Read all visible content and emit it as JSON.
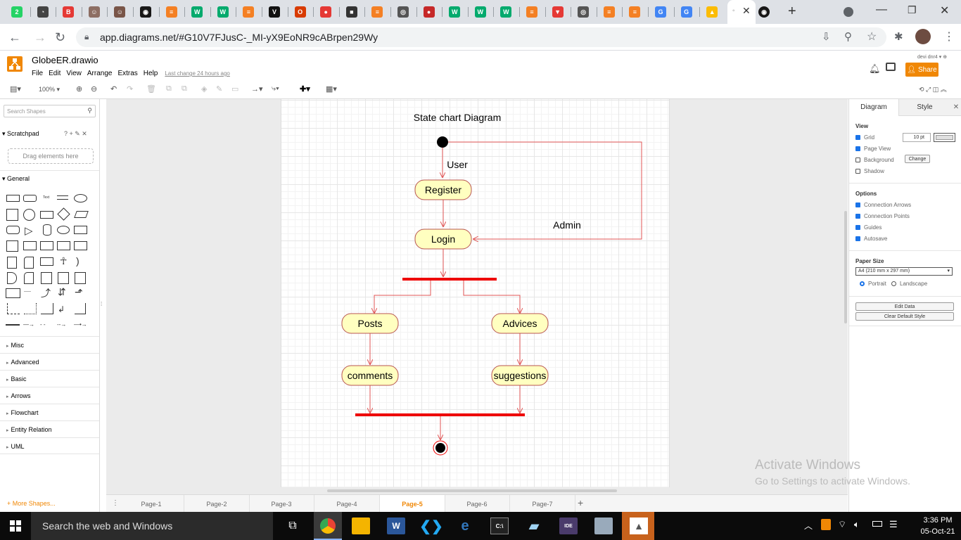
{
  "browser": {
    "url": "app.diagrams.net/#G10V7FJusC-_MI-yX9EoNR9cABrpen29Wy",
    "tabs": [
      {
        "icon": "whatsapp-icon",
        "color": "#25d366",
        "glyph": "2"
      },
      {
        "icon": "app-icon",
        "color": "#444",
        "glyph": "◔"
      },
      {
        "icon": "bookmark-icon",
        "color": "#e53935",
        "glyph": "B"
      },
      {
        "icon": "avatar-icon",
        "color": "#8d6e63",
        "glyph": "☺"
      },
      {
        "icon": "avatar-icon",
        "color": "#795548",
        "glyph": "☺"
      },
      {
        "icon": "github-icon",
        "color": "#181717",
        "glyph": "◉"
      },
      {
        "icon": "stackoverflow-icon",
        "color": "#f48024",
        "glyph": "≡"
      },
      {
        "icon": "w3schools-icon",
        "color": "#04aa6d",
        "glyph": "W"
      },
      {
        "icon": "w3schools-icon",
        "color": "#04aa6d",
        "glyph": "W"
      },
      {
        "icon": "stackoverflow-icon",
        "color": "#f48024",
        "glyph": "≡"
      },
      {
        "icon": "vercel-icon",
        "color": "#111",
        "glyph": "V"
      },
      {
        "icon": "office-icon",
        "color": "#d83b01",
        "glyph": "O"
      },
      {
        "icon": "record-icon",
        "color": "#e53935",
        "glyph": "●"
      },
      {
        "icon": "app-icon",
        "color": "#333",
        "glyph": "■"
      },
      {
        "icon": "stackoverflow-icon",
        "color": "#f48024",
        "glyph": "≡"
      },
      {
        "icon": "chrome-icon",
        "color": "#555",
        "glyph": "◎"
      },
      {
        "icon": "app-icon",
        "color": "#c62828",
        "glyph": "●"
      },
      {
        "icon": "w3schools-icon",
        "color": "#04aa6d",
        "glyph": "W"
      },
      {
        "icon": "w3schools-icon",
        "color": "#04aa6d",
        "glyph": "W"
      },
      {
        "icon": "w3schools-icon",
        "color": "#04aa6d",
        "glyph": "W"
      },
      {
        "icon": "stackoverflow-icon",
        "color": "#f48024",
        "glyph": "≡"
      },
      {
        "icon": "vue-icon",
        "color": "#e53935",
        "glyph": "▼"
      },
      {
        "icon": "chrome-icon",
        "color": "#555",
        "glyph": "◎"
      },
      {
        "icon": "stackoverflow-icon",
        "color": "#f48024",
        "glyph": "≡"
      },
      {
        "icon": "stackoverflow-icon",
        "color": "#f48024",
        "glyph": "≡"
      },
      {
        "icon": "google-icon",
        "color": "#4285f4",
        "glyph": "G"
      },
      {
        "icon": "google-icon",
        "color": "#4285f4",
        "glyph": "G"
      },
      {
        "icon": "drive-icon",
        "color": "#fbbc05",
        "glyph": "▲"
      }
    ]
  },
  "app": {
    "filename": "GlobeER.drawio",
    "menu": [
      "File",
      "Edit",
      "View",
      "Arrange",
      "Extras",
      "Help"
    ],
    "last_change": "Last change 24 hours ago",
    "user": "devi dnr4",
    "share": "Share",
    "zoom": "100%"
  },
  "sidebar": {
    "search_placeholder": "Search Shapes",
    "scratchpad": "Scratchpad",
    "scratchpad_tools": "? + ✎ ✕",
    "drag_here": "Drag elements here",
    "general": "General",
    "sections": [
      "Misc",
      "Advanced",
      "Basic",
      "Arrows",
      "Flowchart",
      "Entity Relation",
      "UML"
    ],
    "more_shapes": "+ More Shapes..."
  },
  "diagram": {
    "title": "State chart Diagram",
    "labels": {
      "user": "User",
      "admin": "Admin"
    },
    "states": {
      "register": "Register",
      "login": "Login",
      "posts": "Posts",
      "advices": "Advices",
      "comments": "comments",
      "suggestions": "suggestions"
    },
    "colors": {
      "state_fill": "#ffffc0",
      "state_stroke": "#b85450",
      "edge": "#e05555",
      "bar": "#ee0000"
    }
  },
  "pages": [
    "Page-1",
    "Page-2",
    "Page-3",
    "Page-4",
    "Page-5",
    "Page-6",
    "Page-7"
  ],
  "active_page": "Page-5",
  "format_panel": {
    "tabs": [
      "Diagram",
      "Style"
    ],
    "view_heading": "View",
    "view_opts": [
      "Grid",
      "Page View",
      "Background",
      "Shadow"
    ],
    "grid_size": "10 pt",
    "change": "Change",
    "options_heading": "Options",
    "options": [
      "Connection Arrows",
      "Connection Points",
      "Guides",
      "Autosave"
    ],
    "paper_heading": "Paper Size",
    "paper_value": "A4 (210 mm x 297 mm)",
    "portrait": "Portrait",
    "landscape": "Landscape",
    "edit_data": "Edit Data",
    "clear_style": "Clear Default Style"
  },
  "watermark": {
    "line1": "Activate Windows",
    "line2": "Go to Settings to activate Windows."
  },
  "taskbar": {
    "search": "Search the web and Windows",
    "time": "3:36 PM",
    "date": "05-Oct-21"
  }
}
